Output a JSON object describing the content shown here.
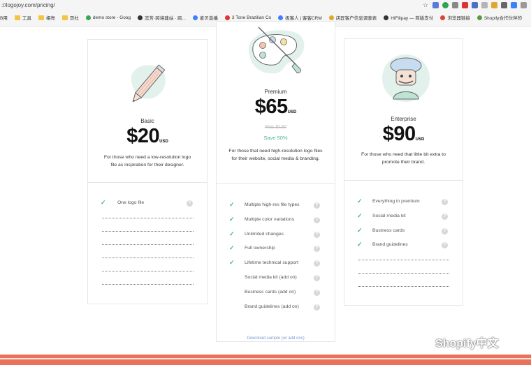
{
  "browser": {
    "url": "://logojoy.com/pricing/",
    "bookmarks": [
      {
        "label": "B用",
        "icon": "none"
      },
      {
        "label": "工具",
        "icon": "folder"
      },
      {
        "label": "相亮",
        "icon": "folder"
      },
      {
        "label": "页杜",
        "icon": "folder"
      },
      {
        "label": "demo store - Goog",
        "icon": "drive"
      },
      {
        "label": "志芳·跨境建站 · 跨...",
        "icon": "dark"
      },
      {
        "label": "麦贝直播",
        "icon": "blue"
      },
      {
        "label": "3 Tone Brazilian Co",
        "icon": "red"
      },
      {
        "label": "极客人 | 客客CRM",
        "icon": "blue"
      },
      {
        "label": "店匠客户信息调查表",
        "icon": "orange"
      },
      {
        "label": "HiFilipay — 简版支付",
        "icon": "dark"
      },
      {
        "label": "浏览器链接",
        "icon": "chrome"
      },
      {
        "label": "Shopify合作伙伴的",
        "icon": "green"
      }
    ]
  },
  "plans": {
    "basic": {
      "name": "Basic",
      "price": "$20",
      "currency": "USD",
      "description": "For those who need a low-resolution logo file as inspiration for their designer.",
      "features": [
        {
          "label": "One logo file",
          "included": true
        }
      ]
    },
    "premium": {
      "name": "Premium",
      "price": "$65",
      "currency": "USD",
      "was": "Was $130",
      "save": "Save 50%",
      "description": "For those that need high-resolution logo files for their website, social media & branding.",
      "features": [
        {
          "label": "Multiple high-res file types",
          "included": true
        },
        {
          "label": "Multiple color variations",
          "included": true
        },
        {
          "label": "Unlimited changes",
          "included": true
        },
        {
          "label": "Full ownership",
          "included": true
        },
        {
          "label": "Lifetime technical support",
          "included": true
        },
        {
          "label": "Social media kit (add on)",
          "included": false
        },
        {
          "label": "Business cards (add on)",
          "included": false
        },
        {
          "label": "Brand guidelines (add on)",
          "included": false
        }
      ],
      "link": "Download sample (w/ add ons)"
    },
    "enterprise": {
      "name": "Enterprise",
      "price": "$90",
      "currency": "USD",
      "description": "For those who need that little bit extra to promote their brand.",
      "features": [
        {
          "label": "Everything in premium",
          "included": true
        },
        {
          "label": "Social media kit",
          "included": true
        },
        {
          "label": "Business cards",
          "included": true
        },
        {
          "label": "Brand guidelines",
          "included": true
        }
      ]
    }
  },
  "watermark": "Shopify中文",
  "colors": {
    "check": "#4fb38a",
    "save": "#52b78a",
    "footer": "#e8735a",
    "blob": "#e2f1ec"
  }
}
